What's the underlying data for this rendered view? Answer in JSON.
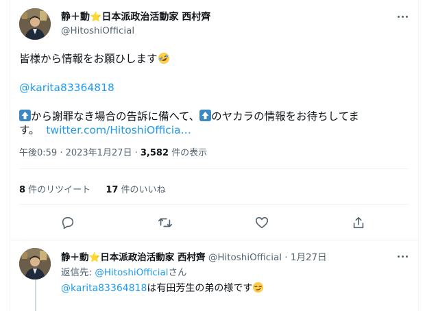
{
  "main_tweet": {
    "author_name": "静＋動⭐日本派政治活動家 西村齊",
    "author_handle": "@HitoshiOfficial",
    "line1": "皆様から情報をお願ひします",
    "mention": "@karita83364818",
    "line3_part1": "から謝罪なき場合の告訴に備へて、",
    "line3_part2": "のヤカラの情報をお待ちしてま",
    "line4_prefix": "す。",
    "link_text": "twitter.com/HitoshiOfficia…",
    "emoji_line1": "rolling-on-floor-laughing-emoji",
    "arrow_icon": "up-arrow-icon",
    "timestamp": "午後0:59 · 2023年1月27日 · ",
    "views_count": "3,582",
    "views_label": " 件の表示"
  },
  "stats": {
    "retweets_count": "8",
    "retweets_label": " 件のリツイート",
    "likes_count": "17",
    "likes_label": " 件のいいね"
  },
  "actions": {
    "reply_icon": "reply-icon",
    "retweet_icon": "retweet-icon",
    "like_icon": "heart-icon",
    "share_icon": "share-icon"
  },
  "reply_tweet": {
    "author_name": "静＋動⭐日本派政治活動家 西村齊",
    "author_handle": "@HitoshiOfficial",
    "separator": " · ",
    "date": "1月27日",
    "reply_to_label": "返信先: ",
    "reply_to_handle": "@HitoshiOfficial",
    "reply_to_suffix": "さん",
    "mention": "@karita83364818",
    "text": "は有田芳生の弟の様です",
    "emoji": "smirking-face-emoji"
  },
  "colors": {
    "link": "#1d9bf0",
    "muted": "#536471",
    "text": "#0f1419",
    "divider": "#eff3f4"
  }
}
